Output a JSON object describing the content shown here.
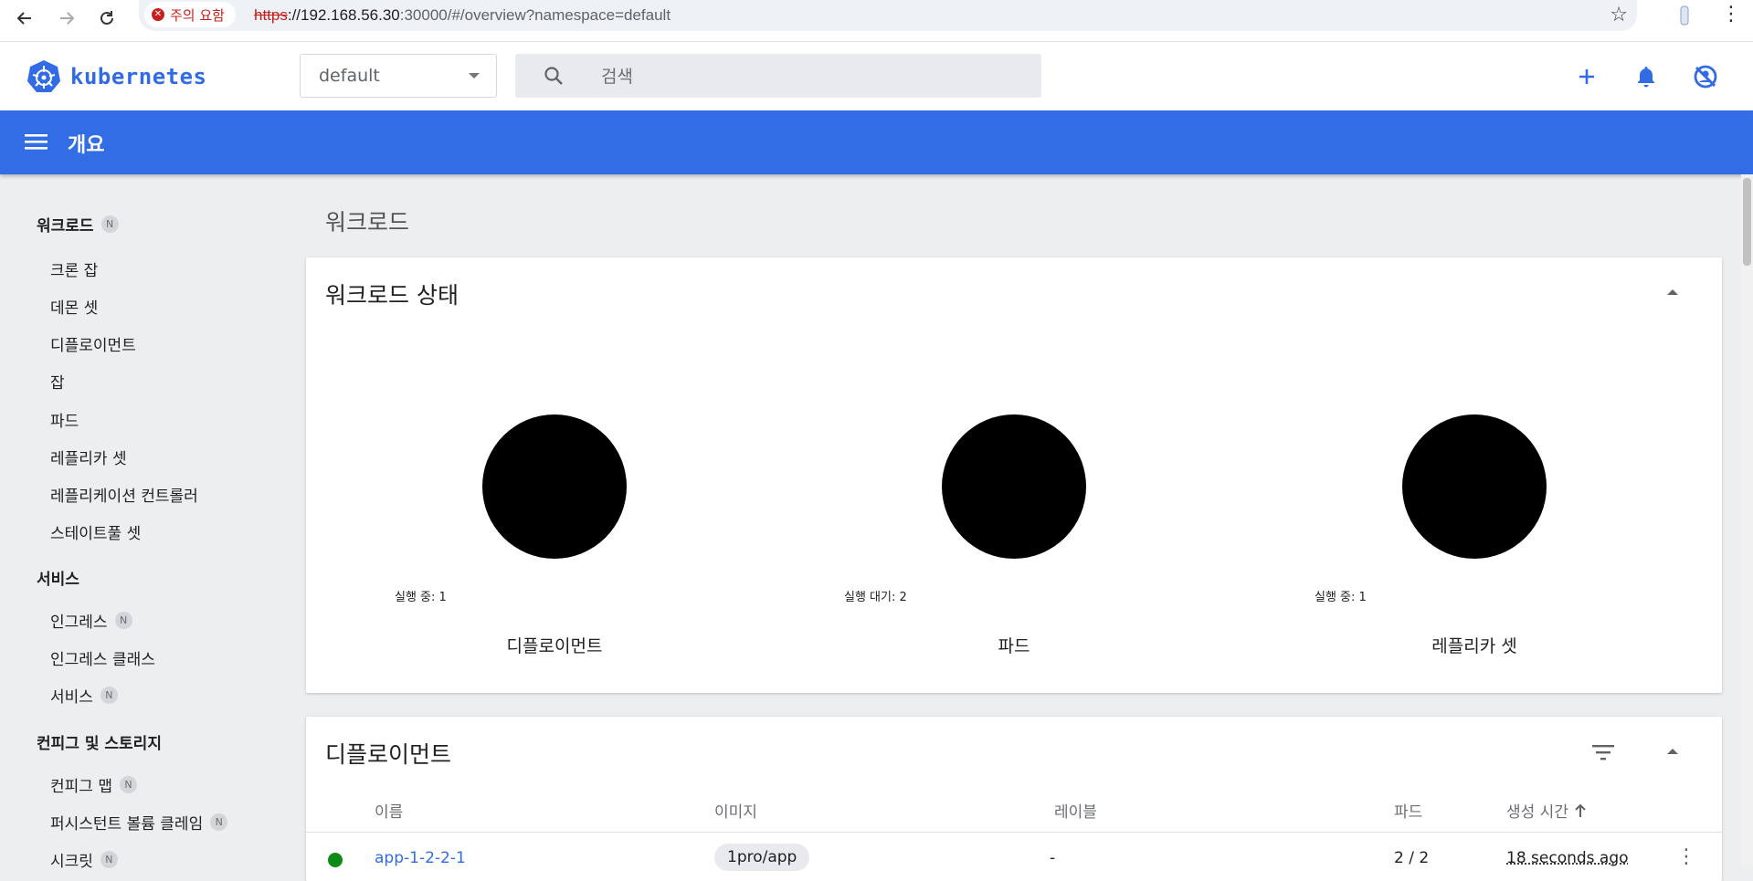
{
  "browser": {
    "security_label": "주의 요함",
    "url_scheme": "https",
    "url_host": "://192.168.56.30",
    "url_rest": ":30000/#/overview?namespace=default"
  },
  "header": {
    "logo_text": "kubernetes",
    "namespace": "default",
    "search_placeholder": "검색"
  },
  "toolbar": {
    "title": "개요"
  },
  "sidebar": {
    "sections": [
      {
        "label": "워크로드",
        "badge": "N",
        "items": [
          {
            "label": "크론 잡"
          },
          {
            "label": "데몬 셋"
          },
          {
            "label": "디플로이먼트"
          },
          {
            "label": "잡"
          },
          {
            "label": "파드"
          },
          {
            "label": "레플리카 셋"
          },
          {
            "label": "레플리케이션 컨트롤러"
          },
          {
            "label": "스테이트풀 셋"
          }
        ]
      },
      {
        "label": "서비스",
        "items": [
          {
            "label": "인그레스",
            "badge": "N"
          },
          {
            "label": "인그레스 클래스"
          },
          {
            "label": "서비스",
            "badge": "N"
          }
        ]
      },
      {
        "label": "컨피그 및 스토리지",
        "items": [
          {
            "label": "컨피그 맵",
            "badge": "N"
          },
          {
            "label": "퍼시스턴트 볼륨 클레임",
            "badge": "N"
          },
          {
            "label": "시크릿",
            "badge": "N"
          }
        ]
      }
    ]
  },
  "main": {
    "section_heading": "워크로드",
    "workload_status": {
      "title": "워크로드 상태",
      "stats": [
        {
          "legend": "실행 중: 1",
          "label": "디플로이먼트"
        },
        {
          "legend": "실행 대기: 2",
          "label": "파드"
        },
        {
          "legend": "실행 중: 1",
          "label": "레플리카 셋"
        }
      ]
    },
    "deployments": {
      "title": "디플로이먼트",
      "columns": {
        "name": "이름",
        "image": "이미지",
        "labels": "레이블",
        "pods": "파드",
        "created": "생성 시간"
      },
      "rows": [
        {
          "name": "app-1-2-2-1",
          "image": "1pro/app",
          "labels": "-",
          "pods": "2 / 2",
          "created": "18 seconds ago"
        }
      ]
    }
  },
  "colors": {
    "brand": "#326ce5",
    "toolbar": "#326de6",
    "running": "#0e8a16"
  }
}
